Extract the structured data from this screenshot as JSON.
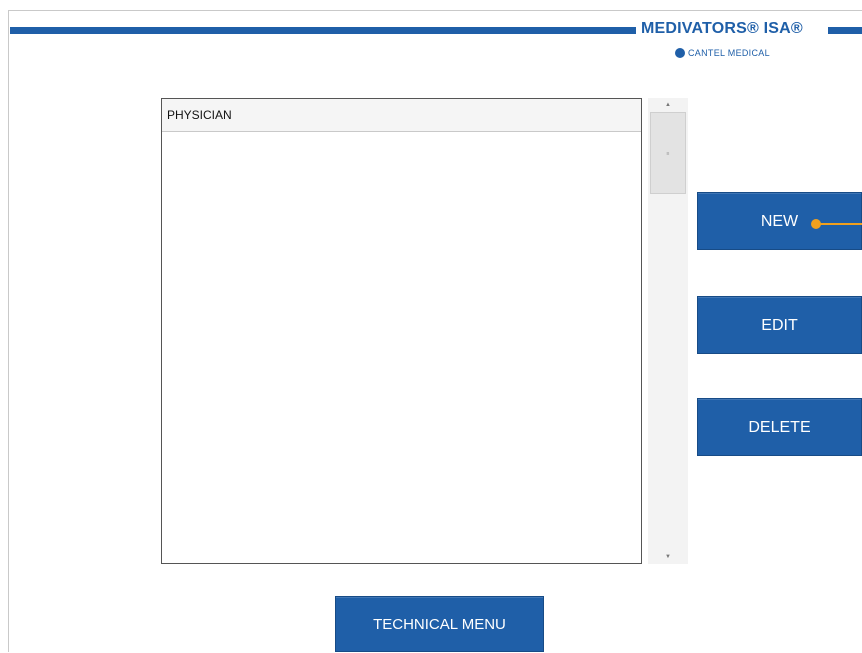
{
  "header": {
    "brand_name": "MEDIVATORS® ISA®",
    "brand_sub": "CANTEL MEDICAL",
    "brand_color": "#1f5fa8"
  },
  "list": {
    "column_header": "PHYSICIAN",
    "rows": []
  },
  "buttons": {
    "new": "NEW",
    "edit": "EDIT",
    "delete": "DELETE",
    "technical_menu": "TECHNICAL MENU"
  },
  "icons": {
    "scroll_up": "up-arrow-icon",
    "scroll_down": "down-arrow-icon",
    "logo": "globe-icon"
  },
  "callout_color": "#f0a01e"
}
